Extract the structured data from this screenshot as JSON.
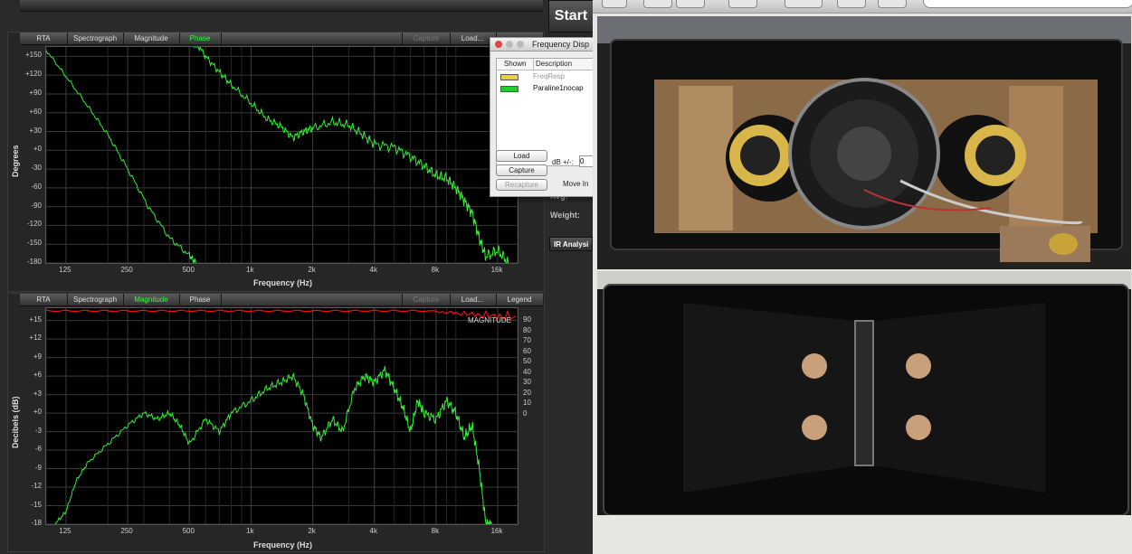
{
  "app": {
    "start_label": "Start",
    "ir_label": "IR Analysi",
    "side_labels": {
      "avg": "Avg:",
      "weight": "Weight:",
      "move": "Move In"
    }
  },
  "phase_panel": {
    "tabs": [
      "RTA",
      "Spectrograph",
      "Magnitude",
      "Phase"
    ],
    "active_tab": "Phase",
    "right_tabs": [
      "Capture",
      "Load..."
    ],
    "ylabel": "Degrees",
    "xlabel": "Frequency (Hz)",
    "yticks": [
      "+150",
      "+120",
      "+90",
      "+60",
      "+30",
      "+0",
      "-30",
      "-60",
      "-90",
      "-120",
      "-150",
      "-180"
    ],
    "xticks": [
      "125",
      "250",
      "500",
      "1k",
      "2k",
      "4k",
      "8k",
      "16k"
    ]
  },
  "mag_panel": {
    "tabs": [
      "RTA",
      "Spectrograph",
      "Magnitude",
      "Phase"
    ],
    "active_tab": "Magnitude",
    "right_tabs": [
      "Capture",
      "Load...",
      "Legend"
    ],
    "ylabel": "Decibels (dB)",
    "xlabel": "Frequency (Hz)",
    "yticks": [
      "+15",
      "+12",
      "+9",
      "+6",
      "+3",
      "+0",
      "-3",
      "-6",
      "-9",
      "-12",
      "-15",
      "-18"
    ],
    "xticks": [
      "125",
      "250",
      "500",
      "1k",
      "2k",
      "4k",
      "8k",
      "16k"
    ],
    "coherence_label": "MAGNITUDE",
    "right_ticks": [
      "90",
      "80",
      "70",
      "60",
      "50",
      "40",
      "30",
      "20",
      "10",
      "0"
    ]
  },
  "dialog": {
    "title": "Frequency Disp",
    "col_shown": "Shown",
    "col_desc": "Description",
    "rows": [
      {
        "name": "FreqResp",
        "color": "#e6d23a",
        "dim": true
      },
      {
        "name": "Paraline1nocap",
        "color": "#22cc33",
        "dim": false
      }
    ],
    "load": "Load",
    "capture": "Capture",
    "recapture": "Recapture",
    "db_label": "dB +/-:",
    "db_value": "0"
  },
  "colors": {
    "trace": "#33ee33",
    "coherence": "#ee1111",
    "grid": "#3a3a3a"
  },
  "chart_data": [
    {
      "type": "line",
      "title": "",
      "xlabel": "Frequency (Hz)",
      "ylabel": "Degrees",
      "x_scale": "log",
      "xlim": [
        100,
        20000
      ],
      "ylim": [
        -180,
        165
      ],
      "series": [
        {
          "x": [
            100,
            125,
            160,
            200,
            250,
            315,
            400,
            500,
            540
          ],
          "y": [
            160,
            118,
            70,
            25,
            -30,
            -90,
            -140,
            -168,
            -180
          ]
        },
        {
          "x": [
            520,
            600,
            700,
            800,
            1000,
            1200,
            1400,
            1600,
            1800,
            2000,
            2500,
            3000,
            3500,
            4000,
            5000,
            6000,
            7000,
            8000,
            9000,
            10000,
            11000,
            12000,
            13000,
            14000,
            16000,
            18000
          ],
          "y": [
            180,
            150,
            125,
            105,
            75,
            50,
            38,
            20,
            30,
            35,
            45,
            40,
            25,
            10,
            5,
            -10,
            -25,
            -40,
            -45,
            -60,
            -80,
            -100,
            -140,
            -170,
            -160,
            -180
          ]
        }
      ]
    },
    {
      "type": "line",
      "title": "",
      "xlabel": "Frequency (Hz)",
      "ylabel": "Decibels (dB)",
      "x_scale": "log",
      "xlim": [
        100,
        20000
      ],
      "ylim": [
        -18,
        17
      ],
      "series": [
        {
          "x": [
            110,
            125,
            140,
            160,
            200,
            250,
            300,
            350,
            400,
            450,
            500,
            600,
            700,
            800,
            1000,
            1200,
            1400,
            1600,
            1800,
            2000,
            2200,
            2500,
            2800,
            3200,
            3600,
            4000,
            4500,
            5000,
            5500,
            6000,
            6500,
            7000,
            8000,
            9000,
            10000,
            11000,
            12000,
            13000,
            14000,
            15000
          ],
          "y": [
            -18,
            -16,
            -11,
            -8,
            -5,
            -2,
            0,
            -1,
            0,
            -2,
            -5,
            -1,
            -3,
            0,
            2,
            4,
            5,
            6,
            3,
            -2,
            -4,
            -1,
            -3,
            4,
            6,
            5,
            7,
            4,
            1,
            -3,
            2,
            0,
            -1,
            2,
            0,
            -4,
            -2,
            -9,
            -18,
            -18
          ]
        }
      ]
    }
  ]
}
